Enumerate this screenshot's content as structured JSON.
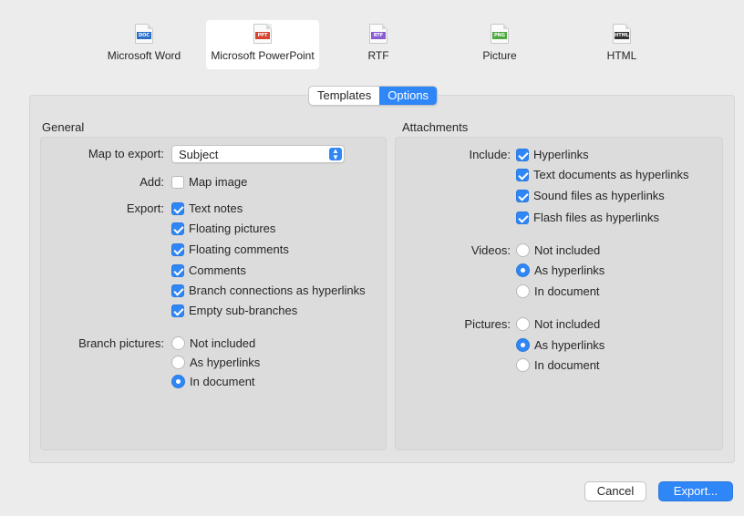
{
  "formats": [
    {
      "label": "Microsoft Word",
      "tag": "DOC",
      "color": "#2b6fc7",
      "selected": false
    },
    {
      "label": "Microsoft PowerPoint",
      "tag": "PPT",
      "color": "#d64532",
      "selected": true
    },
    {
      "label": "RTF",
      "tag": "RTF",
      "color": "#8a5bd6",
      "selected": false
    },
    {
      "label": "Picture",
      "tag": "PNG",
      "color": "#4caa3e",
      "selected": false
    },
    {
      "label": "HTML",
      "tag": "HTML",
      "color": "#333333",
      "selected": false
    }
  ],
  "tabs": {
    "templates": "Templates",
    "options": "Options",
    "active": "Options"
  },
  "general": {
    "title": "General",
    "map_to_export_label": "Map to export:",
    "map_to_export_value": "Subject",
    "add_label": "Add:",
    "map_image": {
      "label": "Map image",
      "checked": false
    },
    "export_label": "Export:",
    "export_options": [
      {
        "label": "Text notes",
        "checked": true
      },
      {
        "label": "Floating pictures",
        "checked": true
      },
      {
        "label": "Floating comments",
        "checked": true
      },
      {
        "label": "Comments",
        "checked": true
      },
      {
        "label": "Branch connections as hyperlinks",
        "checked": true
      },
      {
        "label": "Empty sub-branches",
        "checked": true
      }
    ],
    "branch_pictures_label": "Branch pictures:",
    "branch_pictures": [
      {
        "label": "Not included",
        "selected": false
      },
      {
        "label": "As hyperlinks",
        "selected": false
      },
      {
        "label": "In document",
        "selected": true
      }
    ]
  },
  "attachments": {
    "title": "Attachments",
    "include_label": "Include:",
    "include_options": [
      {
        "label": "Hyperlinks",
        "checked": true
      },
      {
        "label": "Text documents as hyperlinks",
        "checked": true
      },
      {
        "label": "Sound files as hyperlinks",
        "checked": true
      },
      {
        "label": "Flash files as hyperlinks",
        "checked": true
      }
    ],
    "videos_label": "Videos:",
    "videos": [
      {
        "label": "Not included",
        "selected": false
      },
      {
        "label": "As hyperlinks",
        "selected": true
      },
      {
        "label": "In document",
        "selected": false
      }
    ],
    "pictures_label": "Pictures:",
    "pictures": [
      {
        "label": "Not included",
        "selected": false
      },
      {
        "label": "As hyperlinks",
        "selected": true
      },
      {
        "label": "In document",
        "selected": false
      }
    ]
  },
  "buttons": {
    "cancel": "Cancel",
    "export": "Export..."
  },
  "colors": {
    "accent": "#2f86f6"
  }
}
